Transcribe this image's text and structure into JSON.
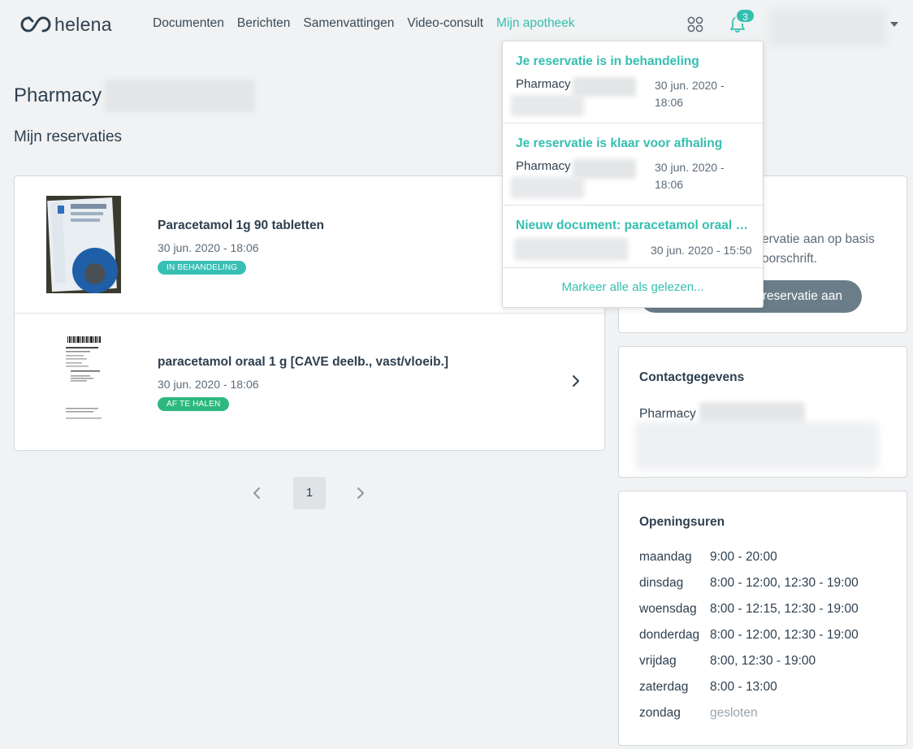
{
  "brand": {
    "logo_text": "helena"
  },
  "nav": {
    "links": [
      "Documenten",
      "Berichten",
      "Samenvattingen",
      "Video-consult",
      "Mijn apotheek"
    ],
    "notification_count": "3"
  },
  "page": {
    "pharmacy_title": "Pharmacy",
    "section_title": "Mijn reservaties"
  },
  "reservations": [
    {
      "name": "Paracetamol 1g 90 tabletten",
      "date": "30 jun. 2020 - 18:06",
      "status": "IN BEHANDELING"
    },
    {
      "name": "paracetamol oraal 1 g [CAVE deelb., vast/vloeib.]",
      "date": "30 jun. 2020 - 18:06",
      "status": "AF TE HALEN"
    }
  ],
  "pagination": {
    "current": "1"
  },
  "new_reservation": {
    "text_line_1": "ervatie aan op basis",
    "text_line_2": "oorschrift.",
    "button_label": "reservatie aan"
  },
  "contact": {
    "title": "Contactgegevens",
    "name": "Pharmacy"
  },
  "hours": {
    "title": "Openingsuren",
    "days": [
      {
        "day": "maandag",
        "time": "9:00 - 20:00"
      },
      {
        "day": "dinsdag",
        "time": "8:00 - 12:00, 12:30 - 19:00"
      },
      {
        "day": "woensdag",
        "time": "8:00 - 12:15, 12:30 - 19:00"
      },
      {
        "day": "donderdag",
        "time": "8:00 - 12:00, 12:30 - 19:00"
      },
      {
        "day": "vrijdag",
        "time": "8:00, 12:30 - 19:00"
      },
      {
        "day": "zaterdag",
        "time": "8:00 - 13:00"
      },
      {
        "day": "zondag",
        "time": "gesloten"
      }
    ]
  },
  "notifications": {
    "items": [
      {
        "title": "Je reservatie is in behandeling",
        "from": "Pharmacy",
        "date": "30 jun. 2020 - 18:06"
      },
      {
        "title": "Je reservatie is klaar voor afhaling",
        "from": "Pharmacy",
        "date": "30 jun. 2020 - 18:06"
      },
      {
        "title": "Nieuw document: paracetamol oraal 1...",
        "from": "",
        "date": "30 jun. 2020 - 15:50"
      }
    ],
    "mark_all_label": "Markeer alle als gelezen..."
  },
  "colors": {
    "accent": "#35bfb0",
    "badge_processing": "#38bfb4",
    "badge_ready": "#2db87d",
    "button": "#6b7d89"
  },
  "icons": {
    "apps": "apps-grid-icon",
    "bell": "bell-icon",
    "chevron": "chevron-right-icon"
  }
}
